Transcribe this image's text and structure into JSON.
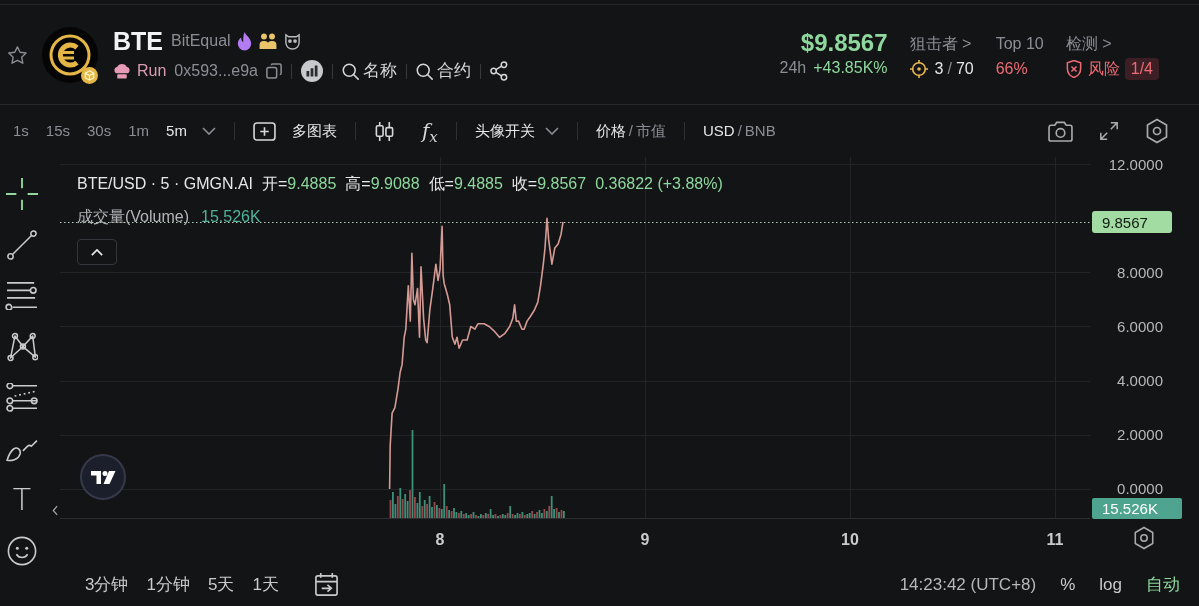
{
  "header": {
    "token": {
      "symbol": "BTE",
      "name": "BitEqual"
    },
    "creator": {
      "label": "Run",
      "address": "0x593...e9a"
    },
    "search_links": [
      {
        "label": "名称"
      },
      {
        "label": "合约"
      }
    ],
    "price": "$9.8567",
    "change_period": "24h",
    "change": "+43.85K%",
    "stats": [
      {
        "kind": "snipers",
        "title": "狙击者 >",
        "count": "3",
        "separator": "/",
        "total": "70"
      },
      {
        "kind": "holders",
        "title": "Top 10",
        "value": "66%"
      },
      {
        "kind": "risk",
        "title": "检测 >",
        "value": "风险",
        "badge": "1/4"
      }
    ]
  },
  "toolbar": {
    "intervals": [
      {
        "label": "1s",
        "selected": false
      },
      {
        "label": "15s",
        "selected": false
      },
      {
        "label": "30s",
        "selected": false
      },
      {
        "label": "1m",
        "selected": false
      },
      {
        "label": "5m",
        "selected": true
      }
    ],
    "multi_chart": "多图表",
    "indicators": "f$_{x}$",
    "avatar_toggle": "头像开关",
    "price_mode": {
      "separator": "/",
      "options": [
        {
          "label": "价格",
          "selected": true
        },
        {
          "label": "市值",
          "selected": false
        }
      ]
    },
    "currency": {
      "separator": "/",
      "options": [
        {
          "label": "USD",
          "selected": true
        },
        {
          "label": "BNB",
          "selected": false
        }
      ]
    }
  },
  "drawing_tools": [
    {
      "kind": "cursor",
      "selected": true
    },
    {
      "kind": "line",
      "selected": false
    },
    {
      "kind": "fibonacci",
      "selected": false
    },
    {
      "kind": "pattern",
      "selected": false
    },
    {
      "kind": "projection",
      "selected": false
    },
    {
      "kind": "brush",
      "selected": false
    },
    {
      "kind": "text",
      "label": "T",
      "selected": false
    },
    {
      "kind": "emoji",
      "selected": false
    }
  ],
  "chart": {
    "legend": {
      "title": "BTE/USD · 5 · GMGN.AI",
      "ohlc": [
        {
          "label": "开=",
          "value": "9.4885"
        },
        {
          "label": "高=",
          "value": "9.9088"
        },
        {
          "label": "低=",
          "value": "9.4885"
        },
        {
          "label": "收=",
          "value": "9.8567"
        }
      ],
      "change": "0.36822 (+3.88%)",
      "volume_label": "成交量(Volume)",
      "volume": "15.526K"
    },
    "last_price_tag": "9.8567",
    "volume_tag": "15.526K",
    "chart_data": {
      "type": "line",
      "grid": true,
      "x": [
        7.754,
        7.757,
        7.766,
        7.78,
        7.795,
        7.805,
        7.815,
        7.825,
        7.833,
        7.845,
        7.855,
        7.863,
        7.87,
        7.878,
        7.89,
        7.9,
        7.907,
        7.92,
        7.93,
        7.937,
        7.95,
        7.963,
        7.98,
        7.99,
        8.0,
        8.01,
        8.015,
        8.02,
        8.035,
        8.047,
        8.06,
        8.073,
        8.083,
        8.093,
        8.11,
        8.132,
        8.15,
        8.17,
        8.185,
        8.215,
        8.24,
        8.262,
        8.29,
        8.317,
        8.34,
        8.355,
        8.364,
        8.372,
        8.383,
        8.4,
        8.41,
        8.425,
        8.439,
        8.46,
        8.477,
        8.49,
        8.504,
        8.512,
        8.522,
        8.53,
        8.546,
        8.56,
        8.576,
        8.59,
        8.6
      ],
      "series": [
        {
          "color": "#d69a95",
          "values": [
            0.0,
            1.6,
            2.8,
            3.0,
            3.7,
            4.3,
            4.6,
            5.6,
            5.9,
            7.5,
            6.2,
            8.7,
            7.0,
            6.8,
            7.4,
            5.6,
            8.2,
            6.3,
            5.5,
            5.4,
            6.6,
            7.3,
            8.3,
            7.7,
            8.1,
            9.7,
            7.9,
            7.6,
            7.2,
            6.8,
            5.6,
            5.35,
            5.6,
            5.2,
            5.5,
            5.5,
            6.0,
            5.9,
            6.1,
            6.1,
            6.0,
            5.85,
            5.6,
            5.75,
            6.0,
            6.3,
            6.8,
            6.2,
            6.2,
            5.9,
            5.9,
            6.2,
            6.35,
            6.6,
            6.9,
            7.5,
            8.3,
            8.9,
            10.0,
            9.2,
            8.3,
            8.9,
            9.05,
            9.4,
            9.86
          ]
        }
      ],
      "xlim": [
        6.146,
        11.171
      ],
      "ylim": [
        -1.11,
        12.26
      ],
      "xticks": [
        8,
        9,
        10,
        11
      ],
      "yticks": [
        {
          "value": 0,
          "label": "0.0000"
        },
        {
          "value": 2,
          "label": "2.0000"
        },
        {
          "value": 4,
          "label": "4.0000"
        },
        {
          "value": 6,
          "label": "6.0000"
        },
        {
          "value": 8,
          "label": "8.0000"
        },
        {
          "value": 12,
          "label": "12.0000"
        }
      ]
    }
  },
  "bottom_bar": {
    "ranges": [
      {
        "label": "3分钟"
      },
      {
        "label": "1分钟"
      },
      {
        "label": "5天"
      },
      {
        "label": "1天"
      }
    ],
    "time": "14:23:42 (UTC+8)",
    "scale_options": [
      {
        "label": "%",
        "selected": false
      },
      {
        "label": "log",
        "selected": false
      },
      {
        "label": "自动",
        "selected": true
      }
    ]
  }
}
